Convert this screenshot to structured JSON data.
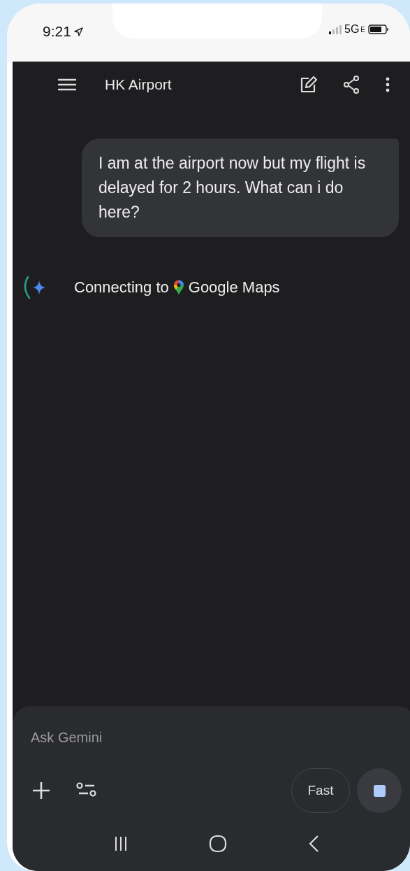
{
  "status_bar": {
    "time": "9:21",
    "network": "5G",
    "network_suffix": "E"
  },
  "header": {
    "title": "HK Airport"
  },
  "messages": [
    {
      "kind": "user",
      "text": "I am at the airport now but my flight is delayed for 2 hours. What can i do here?"
    },
    {
      "kind": "status",
      "text_before": "Connecting to",
      "text_after": "Google Maps"
    }
  ],
  "input": {
    "placeholder": "Ask Gemini",
    "mode_button": "Fast"
  }
}
